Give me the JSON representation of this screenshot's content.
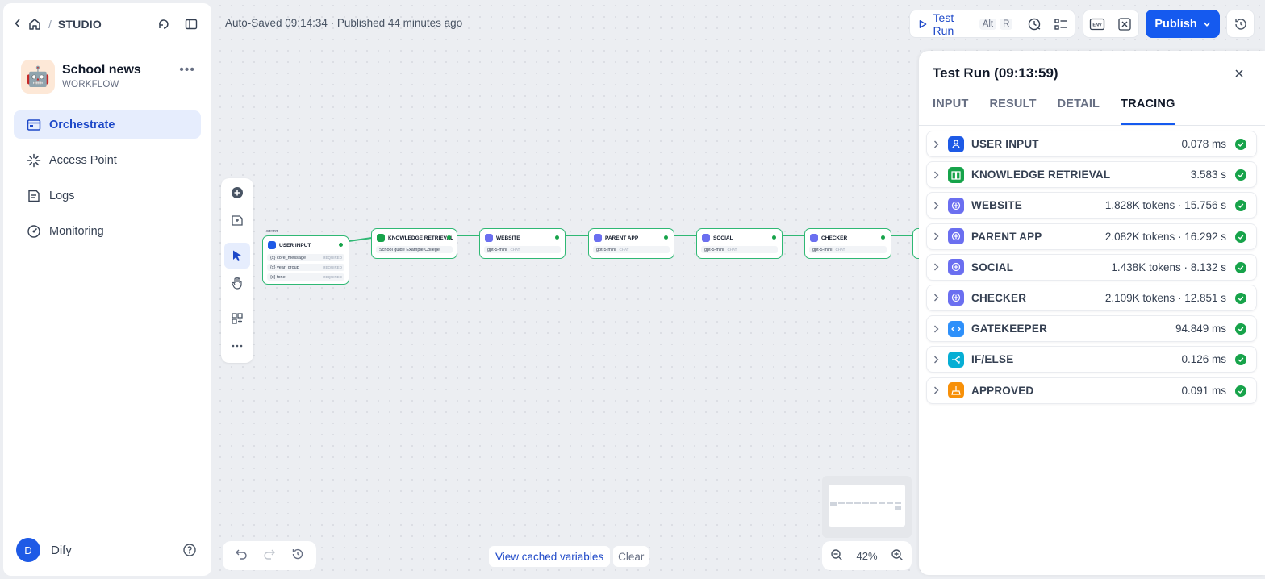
{
  "breadcrumb": {
    "section": "STUDIO"
  },
  "app": {
    "name": "School news",
    "type": "WORKFLOW",
    "avatar": "🤖"
  },
  "nav": [
    {
      "label": "Orchestrate",
      "icon": "orchestrate-icon",
      "active": true
    },
    {
      "label": "Access Point",
      "icon": "access-point-icon",
      "active": false
    },
    {
      "label": "Logs",
      "icon": "logs-icon",
      "active": false
    },
    {
      "label": "Monitoring",
      "icon": "monitoring-icon",
      "active": false
    }
  ],
  "user": {
    "initial": "D",
    "name": "Dify"
  },
  "status": {
    "text": "Auto-Saved 09:14:34 · Published 44 minutes ago"
  },
  "toolbar": {
    "test_run_label": "Test Run",
    "test_run_keys": [
      "Alt",
      "R"
    ],
    "publish_label": "Publish",
    "env_label": "ENV"
  },
  "nodes": {
    "start_label": "START",
    "user_input": {
      "title": "USER INPUT",
      "vars": [
        {
          "name": "{x} core_message",
          "tag": "REQUIRED"
        },
        {
          "name": "{x} year_group",
          "tag": "REQUIRED"
        },
        {
          "name": "{x} tone",
          "tag": "REQUIRED"
        }
      ]
    },
    "knowledge": {
      "title": "KNOWLEDGE RETRIEVAL",
      "row": "School guide Example College"
    },
    "website": {
      "title": "WEBSITE",
      "row": "gpt-5-mini",
      "tag": "CHAT"
    },
    "parent_app": {
      "title": "PARENT APP",
      "row": "gpt-5-mini",
      "tag": "CHAT"
    },
    "social": {
      "title": "SOCIAL",
      "row": "gpt-5-mini",
      "tag": "CHAT"
    },
    "checker": {
      "title": "CHECKER",
      "row": "gpt-5-mini",
      "tag": "CHAT"
    }
  },
  "bottom": {
    "cached_label": "View cached variables",
    "clear_label": "Clear",
    "zoom": "42%"
  },
  "panel": {
    "title": "Test Run (09:13:59)",
    "tabs": [
      "INPUT",
      "RESULT",
      "DETAIL",
      "TRACING"
    ],
    "active_tab": "TRACING",
    "traces": [
      {
        "name": "USER INPUT",
        "meta": "0.078 ms",
        "icon": "user-input-icon",
        "color": "#1e5ae6"
      },
      {
        "name": "KNOWLEDGE RETRIEVAL",
        "meta": "3.583 s",
        "icon": "knowledge-icon",
        "color": "#16a34a"
      },
      {
        "name": "WEBSITE",
        "meta": "1.828K tokens · 15.756 s",
        "icon": "llm-icon",
        "color": "#6b6ff0"
      },
      {
        "name": "PARENT APP",
        "meta": "2.082K tokens · 16.292 s",
        "icon": "llm-icon",
        "color": "#6b6ff0"
      },
      {
        "name": "SOCIAL",
        "meta": "1.438K tokens · 8.132 s",
        "icon": "llm-icon",
        "color": "#6b6ff0"
      },
      {
        "name": "CHECKER",
        "meta": "2.109K tokens · 12.851 s",
        "icon": "llm-icon",
        "color": "#6b6ff0"
      },
      {
        "name": "GATEKEEPER",
        "meta": "94.849 ms",
        "icon": "code-icon",
        "color": "#2e90fa"
      },
      {
        "name": "IF/ELSE",
        "meta": "0.126 ms",
        "icon": "if-else-icon",
        "color": "#06aed4"
      },
      {
        "name": "APPROVED",
        "meta": "0.091 ms",
        "icon": "end-icon",
        "color": "#f79009"
      }
    ]
  }
}
